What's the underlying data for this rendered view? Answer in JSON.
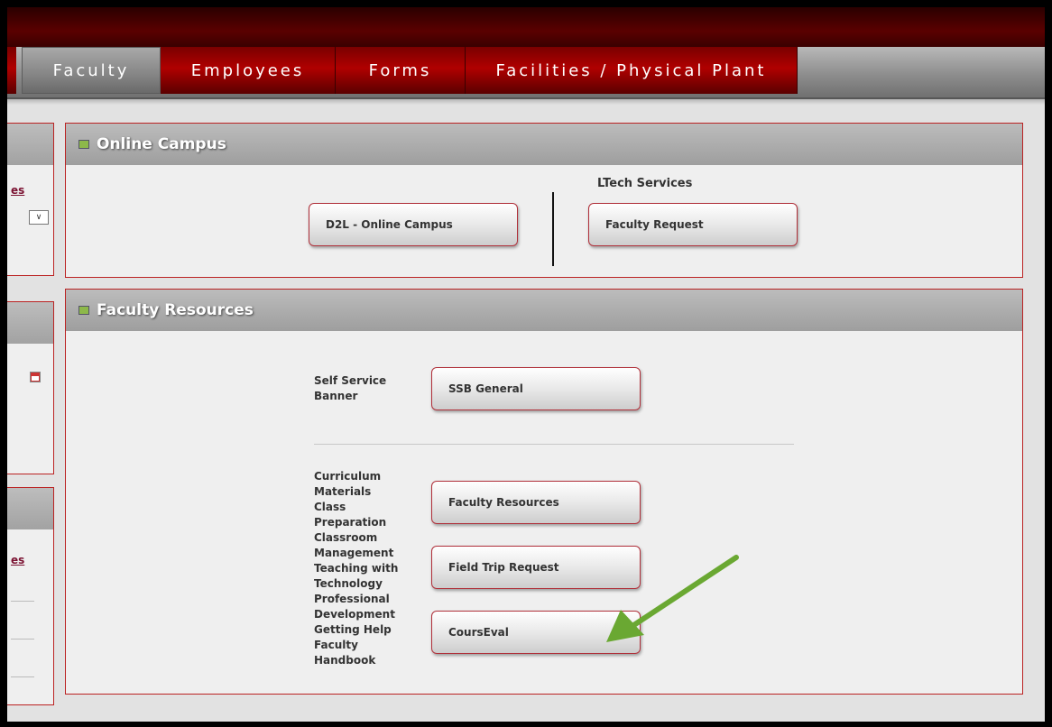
{
  "nav": {
    "tabs": [
      {
        "label": "Faculty",
        "active": true
      },
      {
        "label": "Employees",
        "active": false
      },
      {
        "label": "Forms",
        "active": false
      },
      {
        "label": "Facilities / Physical Plant",
        "active": false
      }
    ]
  },
  "sidebar_fragments": {
    "link1": "es",
    "select_glyph": "∨",
    "link2": "es"
  },
  "online_campus": {
    "title": "Online Campus",
    "d2l_button": "D2L - Online Campus",
    "ltech_heading": "LTech Services",
    "faculty_request_button": "Faculty Request"
  },
  "faculty_resources": {
    "title": "Faculty Resources",
    "ssb_label_lines": [
      "Self Service",
      "Banner"
    ],
    "ssb_button": "SSB General",
    "topics": [
      "Curriculum",
      "Materials",
      "Class",
      "Preparation",
      "Classroom",
      "Management",
      "Teaching with",
      "Technology",
      "Professional",
      "Development",
      "Getting Help",
      "Faculty",
      "Handbook"
    ],
    "faculty_resources_button": "Faculty Resources",
    "field_trip_button": "Field Trip Request",
    "courseval_button": "CoursEval"
  },
  "colors": {
    "tab_red": "#b00000",
    "border_red": "#b22222",
    "arrow_green": "#6aa832"
  }
}
